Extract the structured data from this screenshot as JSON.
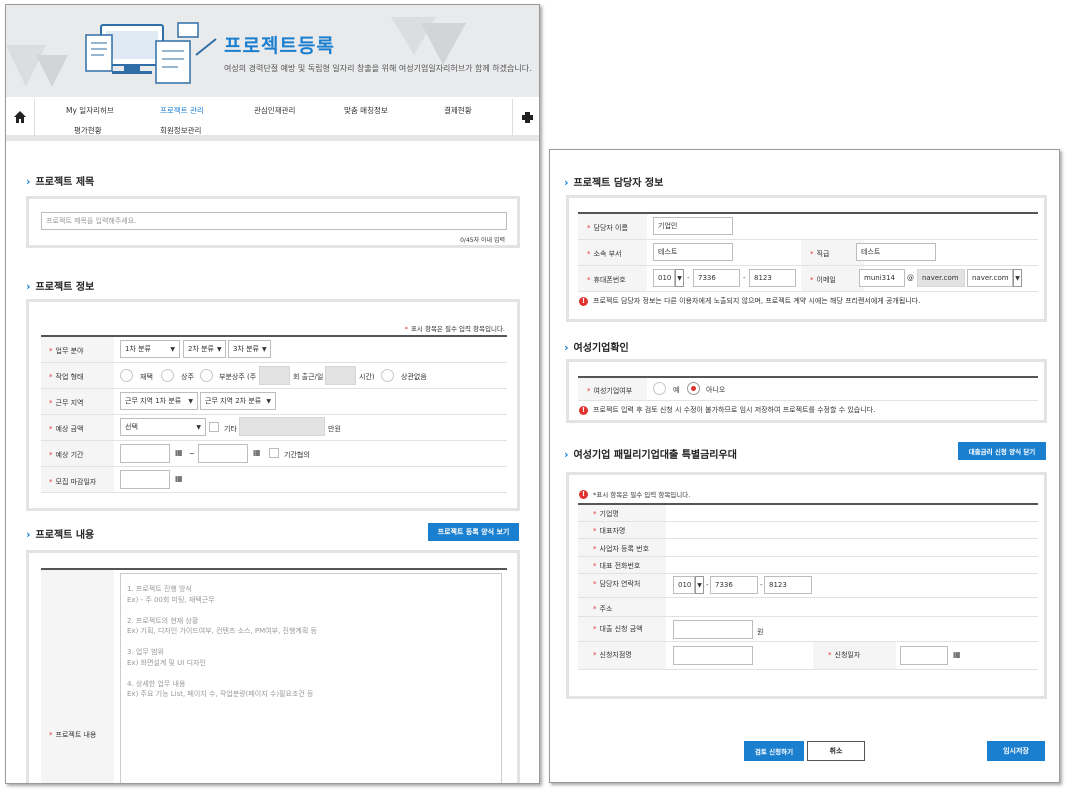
{
  "banner": {
    "title": "프로젝트등록",
    "subtitle": "여성의 경력단절 예방 및 독립형 일자리 창출을 위해 여성기업일자리허브가 함께 하겠습니다."
  },
  "nav": {
    "items": [
      "My 일자리허브",
      "프로젝트 관리",
      "관심인재관리",
      "맞춤 매칭정보",
      "결제현황",
      "평가현황",
      "회원정보관리"
    ],
    "active_index": 1
  },
  "project_title": {
    "heading": "프로젝트 제목",
    "placeholder": "프로젝트 제목을 입력해주세요.",
    "counter": "0/45자 이내 입력"
  },
  "project_info": {
    "heading": "프로젝트 정보",
    "required_note": "표시 항목은 필수 입력 항목입니다.",
    "required_mark": "*",
    "field": {
      "label": "업무 분야",
      "sel1": "1차 분류",
      "sel2": "2차 분류",
      "sel3": "3차 분류"
    },
    "work_type": {
      "label": "작업 형태",
      "opt1": "재택",
      "opt2": "상주",
      "opt3_pre": "부분상주 (주",
      "opt3_mid": "회 출근/일",
      "opt3_post": "시간)",
      "opt4": "상관없음"
    },
    "region": {
      "label": "근무 지역",
      "sel1": "근무 지역 1차 분류",
      "sel2": "근무 지역 2차 분류"
    },
    "amount": {
      "label": "예상 금액",
      "select": "선택",
      "etc": "기타",
      "unit": "만원"
    },
    "period": {
      "label": "예상 기간",
      "tilde": "~",
      "negotiable": "기간협의"
    },
    "deadline": {
      "label": "모집 마감일자"
    }
  },
  "project_content": {
    "heading": "프로젝트 내용",
    "form_button": "프로젝트 등록 양식 보기",
    "label": "프로젝트 내용",
    "guide": "1. 프로젝트 진행 방식\nEx) - 주 00회 미팅, 재택근무\n\n2. 프로젝트의 현재 상황\nEx) 기획, 디자인 가이드여부, 컨텐츠 소스, PM여부, 진행계획 등\n\n3. 업무 범위\nEx) 화면설계 및 UI 디자인\n\n4. 상세한 업무 내용\nEx) 주요 기능 List, 페이지 수, 작업분량(페이지 수)필요조건 등"
  },
  "manager": {
    "heading": "프로젝트 담당자 정보",
    "name_label": "담당자 이름",
    "name_value": "기업인",
    "dept_label": "소속 부서",
    "dept_value": "테스트",
    "title_label": "직급",
    "title_value": "테스트",
    "phone_label": "휴대폰번호",
    "phone1": "010",
    "phone2": "7336",
    "phone3": "8123",
    "email_label": "이메일",
    "email_id": "muni314",
    "at": "@",
    "email_domain": "naver.com",
    "email_select": "naver.com",
    "dash": "-",
    "notice": "프로젝트 담당자 정보는 다른 이용자에게 노출되지 않으며, 프로젝트 계약 시에는 해당 프리랜서에게 공개됩니다."
  },
  "women_biz": {
    "heading": "여성기업확인",
    "label": "여성기업여부",
    "yes": "예",
    "no": "아니오",
    "selected": "no",
    "notice": "프로젝트 입력 후 검토 신청 시 수정이 불가하므로 임시 저장하여 프로젝트를 수정할 수 있습니다."
  },
  "loan": {
    "heading": "여성기업 패밀리기업대출 특별금리우대",
    "close_button": "대출금리 신청 양식 닫기",
    "required_note": "*표시 항목은 필수 입력 항목입니다.",
    "company_label": "기업명",
    "ceo_label": "대표자명",
    "bizno_label": "사업자 등록 번호",
    "tel_label": "대표 전화번호",
    "contact_label": "담당자 연락처",
    "phone1": "010",
    "phone2": "7336",
    "phone3": "8123",
    "address_label": "주소",
    "amount_label": "대출 신청 금액",
    "amount_unit": "원",
    "branch_label": "신청지점명",
    "date_label": "신청일자"
  },
  "actions": {
    "submit": "검토 신청하기",
    "cancel": "취소",
    "temp_save": "임시저장"
  },
  "colors": {
    "accent": "#1b7fd0",
    "required": "#e0322e"
  }
}
